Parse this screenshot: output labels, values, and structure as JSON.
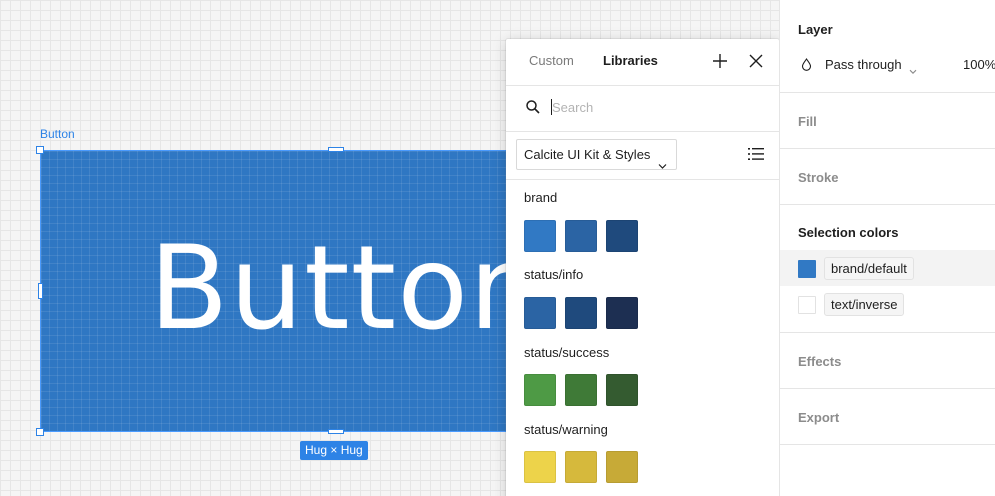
{
  "canvas": {
    "frame_label": "Button",
    "frame_text": "Button",
    "frame_color": "#2f77c3",
    "resize_badge": "Hug × Hug"
  },
  "picker": {
    "tabs": [
      {
        "label": "Custom",
        "active": false
      },
      {
        "label": "Libraries",
        "active": true
      }
    ],
    "icons": {
      "add": "plus-icon",
      "close": "close-icon",
      "search": "search-icon",
      "list": "list-view-icon"
    },
    "search": {
      "value": "",
      "placeholder": "Search"
    },
    "library": {
      "selected": "Calcite UI Kit & Styles"
    },
    "groups": [
      {
        "label": "brand",
        "colors": [
          "#3179c4",
          "#2b64a4",
          "#1f4a7d"
        ]
      },
      {
        "label": "status/info",
        "colors": [
          "#2b64a4",
          "#1f4a7d",
          "#1d2f52"
        ]
      },
      {
        "label": "status/success",
        "colors": [
          "#4e9a45",
          "#3f7a37",
          "#345b30"
        ]
      },
      {
        "label": "status/warning",
        "colors": [
          "#edd34a",
          "#d6b93c",
          "#c7aa37"
        ]
      }
    ]
  },
  "panel": {
    "layer": {
      "title": "Layer",
      "blend_mode": "Pass through",
      "opacity": "100%"
    },
    "fill": {
      "title": "Fill"
    },
    "stroke": {
      "title": "Stroke"
    },
    "selection_colors": {
      "title": "Selection colors",
      "items": [
        {
          "name": "brand/default",
          "color": "#3179c4"
        },
        {
          "name": "text/inverse",
          "color": "#ffffff"
        }
      ]
    },
    "effects": {
      "title": "Effects"
    },
    "export": {
      "title": "Export"
    }
  }
}
